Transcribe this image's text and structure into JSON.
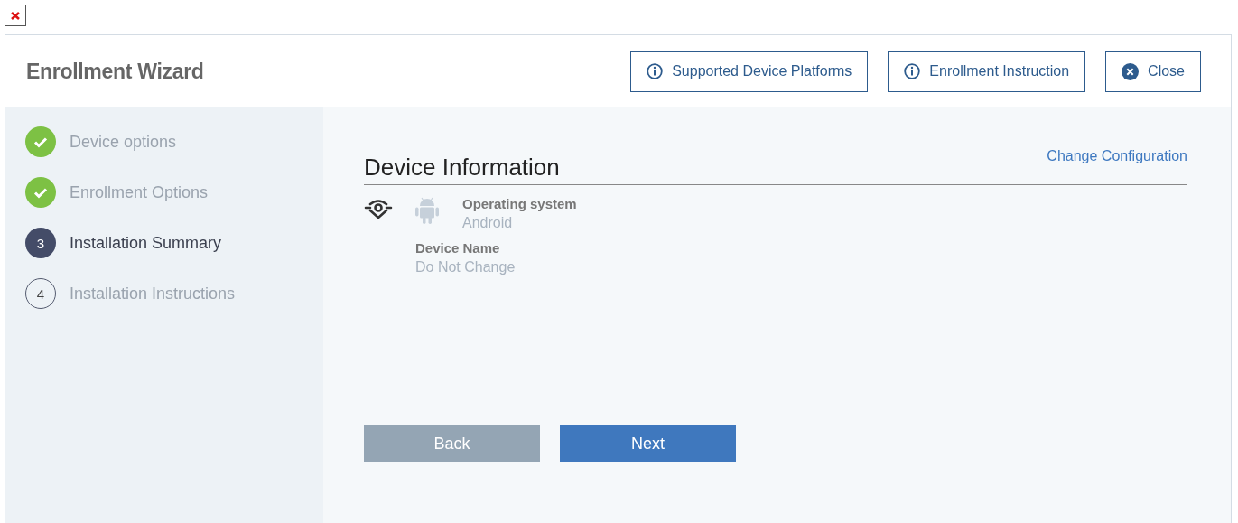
{
  "window": {
    "title": "Enrollment Wizard"
  },
  "header_buttons": [
    {
      "label": "Supported Device Platforms",
      "kind": "info"
    },
    {
      "label": "Enrollment Instruction",
      "kind": "info"
    },
    {
      "label": "Close",
      "kind": "close"
    }
  ],
  "steps": [
    {
      "label": "Device options",
      "completed": true,
      "selected": false
    },
    {
      "label": "Enrollment Options",
      "completed": true,
      "selected": false
    },
    {
      "label": "Installation Summary",
      "completed": false,
      "selected": true,
      "number": "3"
    },
    {
      "label": "Installation Instructions",
      "completed": false,
      "selected": false,
      "number": "4"
    }
  ],
  "section": {
    "title": "Device Information",
    "link": "Change Configuration"
  },
  "fields": [
    {
      "label": "Operating system",
      "value": "Android"
    },
    {
      "label": "Device Name",
      "value": "Do Not Change"
    }
  ],
  "buttons": [
    {
      "label": "Back",
      "disabled": true
    },
    {
      "label": "Next",
      "disabled": false
    }
  ]
}
